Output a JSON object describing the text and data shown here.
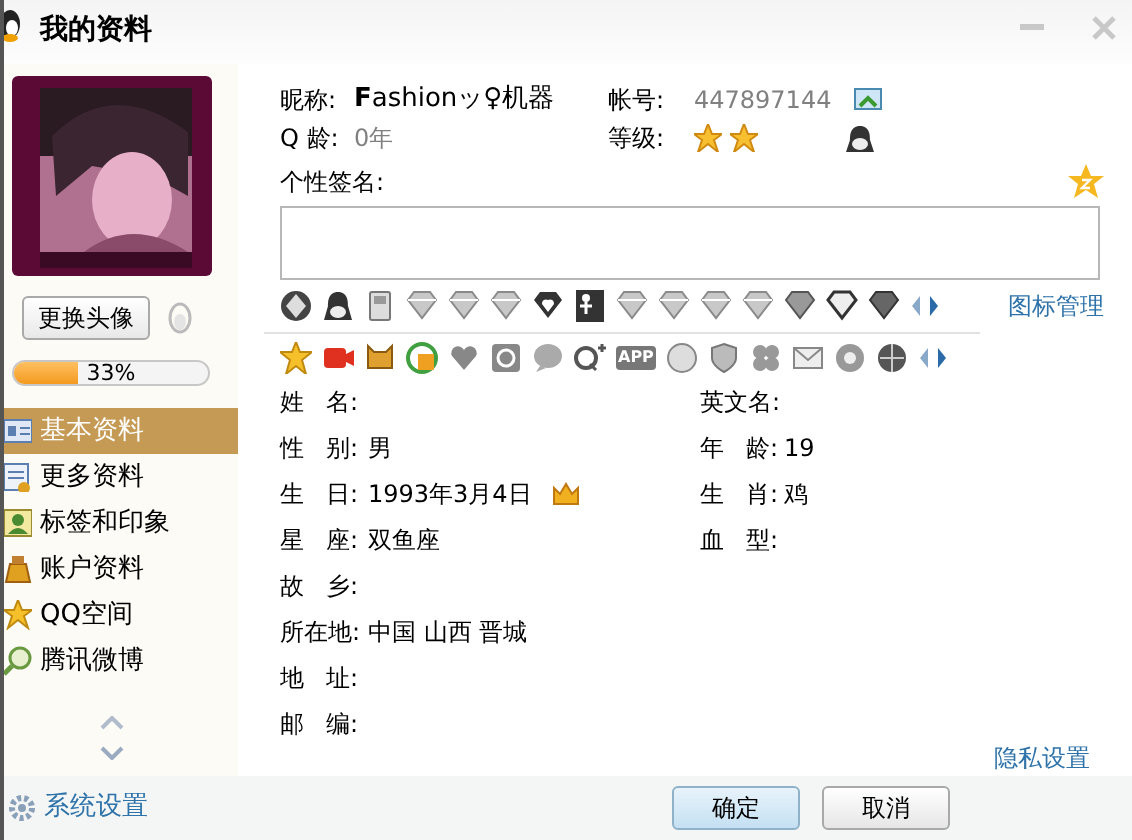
{
  "window": {
    "title": "我的资料"
  },
  "sidebar": {
    "change_avatar_button": "更换头像",
    "completion": {
      "level": 0.33,
      "reading": "33%"
    },
    "items": [
      {
        "label": "基本资料",
        "selected": true
      },
      {
        "label": "更多资料",
        "selected": false
      },
      {
        "label": "标签和印象",
        "selected": false
      },
      {
        "label": "账户资料",
        "selected": false
      },
      {
        "label": "QQ空间",
        "selected": false
      },
      {
        "label": "腾讯微博",
        "selected": false
      }
    ]
  },
  "profile": {
    "nickname_label": "昵称:",
    "nickname": "**F**ashionッ♀机器",
    "account_label": "帐号:",
    "account": "447897144",
    "qage_label": "Q 龄:",
    "qage": "0年",
    "level_label": "等级:",
    "level_icons": [
      {
        "kind": "star"
      },
      {
        "kind": "star"
      }
    ],
    "signature_label": "个性签名:",
    "icon_manager_link": "图标管理",
    "app_icon_label": "APP"
  },
  "fields": {
    "left": [
      {
        "label": "姓 名:"
      },
      {
        "label": "性 别:",
        "value": "男"
      },
      {
        "label": "生 日:",
        "value": "1993年3月4日",
        "kind": "birthday"
      },
      {
        "label": "星 座:",
        "value": "双鱼座"
      },
      {
        "label": "故 乡:"
      },
      {
        "label": "所在地:",
        "value": "中国 山西 晋城"
      },
      {
        "label": "地 址:"
      },
      {
        "label": "邮 编:"
      }
    ],
    "right": [
      {
        "label": "英文名:"
      },
      {
        "label": "年 龄:",
        "value": "19"
      },
      {
        "label": "生 肖:",
        "value": "鸡"
      },
      {
        "label": "血 型:"
      }
    ]
  },
  "privacy_link": "隐私设置",
  "footer": {
    "settings": "系统设置",
    "buttons": [
      {
        "label": "确定",
        "kind": "primary"
      },
      {
        "label": "取消",
        "kind": "normal"
      }
    ]
  }
}
